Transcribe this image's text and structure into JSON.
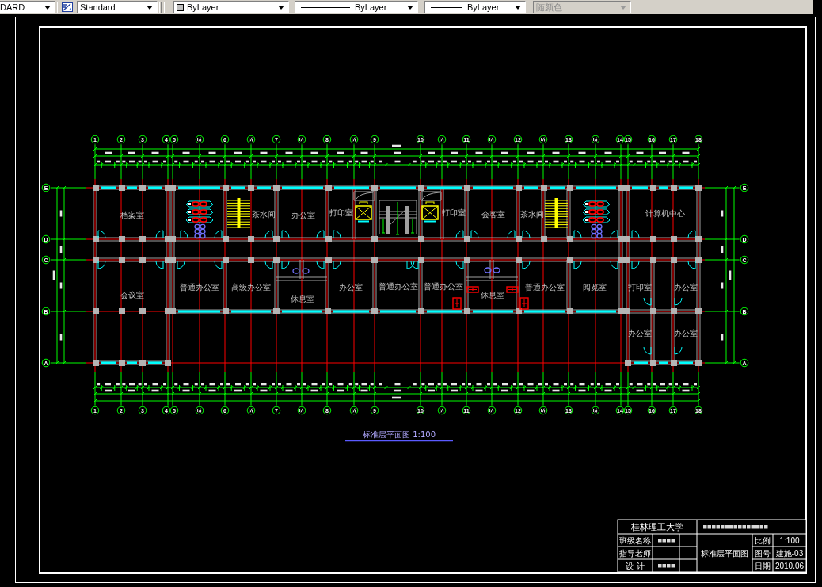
{
  "toolbar": [
    {
      "kind": "plain",
      "value": "DARD",
      "disabled": false
    },
    {
      "kind": "styled",
      "value": "Standard",
      "disabled": false
    },
    {
      "kind": "color",
      "value": "ByLayer",
      "disabled": false
    },
    {
      "kind": "linetype",
      "value": "ByLayer",
      "disabled": false
    },
    {
      "kind": "lineweight",
      "value": "ByLayer",
      "disabled": false
    },
    {
      "kind": "plain",
      "value": "随颜色",
      "disabled": true
    }
  ],
  "plan": {
    "column_axes_top": [
      {
        "kind": "main",
        "label": "1"
      },
      {
        "kind": "main",
        "label": "2"
      },
      {
        "kind": "main",
        "label": "3"
      },
      {
        "kind": "main",
        "label": "4"
      },
      {
        "kind": "main",
        "label": "5"
      },
      {
        "kind": "sub"
      },
      {
        "kind": "main",
        "label": "6"
      },
      {
        "kind": "sub"
      },
      {
        "kind": "main",
        "label": "7"
      },
      {
        "kind": "sub"
      },
      {
        "kind": "main",
        "label": "8"
      },
      {
        "kind": "sub"
      },
      {
        "kind": "main",
        "label": "9"
      },
      {
        "kind": "main",
        "label": "10"
      },
      {
        "kind": "sub"
      },
      {
        "kind": "main",
        "label": "11"
      },
      {
        "kind": "sub"
      },
      {
        "kind": "main",
        "label": "12"
      },
      {
        "kind": "sub"
      },
      {
        "kind": "main",
        "label": "13"
      },
      {
        "kind": "sub"
      },
      {
        "kind": "main",
        "label": "14"
      },
      {
        "kind": "main",
        "label": "15"
      },
      {
        "kind": "main",
        "label": "16"
      },
      {
        "kind": "main",
        "label": "17"
      },
      {
        "kind": "main",
        "label": "18"
      }
    ],
    "column_axes_bottom": [
      {
        "kind": "main",
        "label": "1"
      },
      {
        "kind": "main",
        "label": "2"
      },
      {
        "kind": "main",
        "label": "3"
      },
      {
        "kind": "main",
        "label": "4"
      },
      {
        "kind": "main",
        "label": "5"
      },
      {
        "kind": "sub"
      },
      {
        "kind": "main",
        "label": "6"
      },
      {
        "kind": "sub"
      },
      {
        "kind": "main",
        "label": "7"
      },
      {
        "kind": "sub"
      },
      {
        "kind": "main",
        "label": "8"
      },
      {
        "kind": "sub"
      },
      {
        "kind": "main",
        "label": "9"
      },
      {
        "kind": "main",
        "label": "10"
      },
      {
        "kind": "sub"
      },
      {
        "kind": "main",
        "label": "11"
      },
      {
        "kind": "sub"
      },
      {
        "kind": "main",
        "label": "12"
      },
      {
        "kind": "sub"
      },
      {
        "kind": "main",
        "label": "13"
      },
      {
        "kind": "sub"
      },
      {
        "kind": "main",
        "label": "14"
      },
      {
        "kind": "main",
        "label": "15"
      },
      {
        "kind": "main",
        "label": "16"
      },
      {
        "kind": "main",
        "label": "17"
      },
      {
        "kind": "main",
        "label": "18"
      }
    ],
    "row_axes_left": [
      "E",
      "D",
      "C",
      "B",
      "A"
    ],
    "row_axes_right": [
      "E",
      "D",
      "C",
      "B",
      "A"
    ],
    "rooms": [
      "档案室",
      "茶水间",
      "办公室",
      "打印室",
      "打印室",
      "会客室",
      "茶水间",
      "计算机中心",
      "会议室",
      "普通办公室",
      "高级办公室",
      "休息室",
      "办公室",
      "普通办公室",
      "普通办公室",
      "休息室",
      "普通办公室",
      "阅览室",
      "打印室",
      "办公室",
      "办公室",
      "办公室"
    ],
    "title": "标准层平面图 1:100"
  },
  "title_block": {
    "school": "桂林理工大学",
    "drawing_name": "标准层平面图",
    "left_rows": [
      {
        "label": "班级名称",
        "smudged": true
      },
      {
        "label": "指导老师",
        "smudged": false
      },
      {
        "label": "设 计",
        "smudged": true
      }
    ],
    "right_rows": [
      {
        "label": "比例",
        "value": "1:100"
      },
      {
        "label": "图号",
        "value": "建施-03"
      },
      {
        "label": "日期",
        "value": "2010.06"
      }
    ]
  }
}
